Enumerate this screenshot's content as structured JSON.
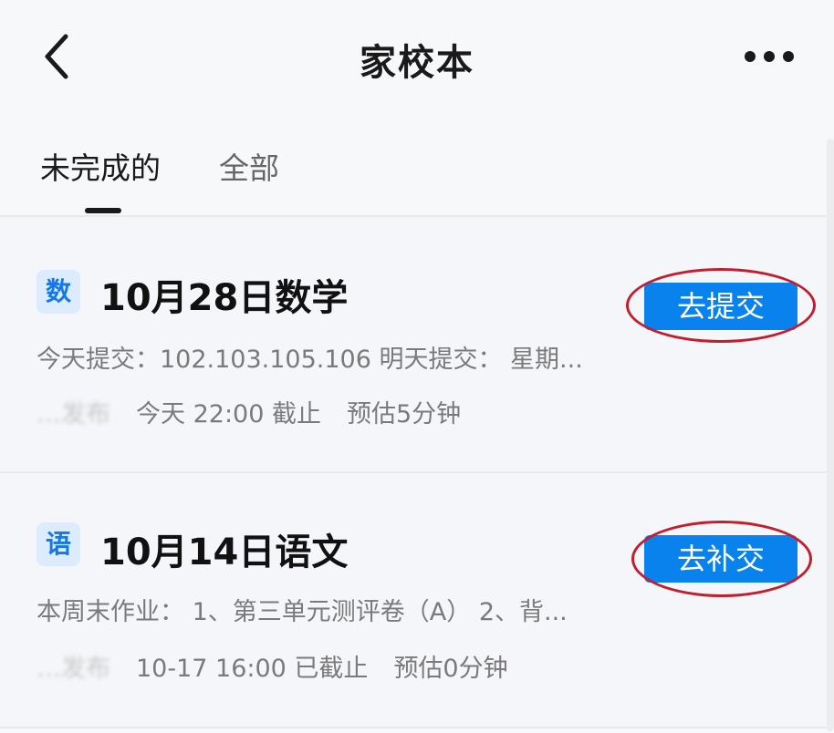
{
  "header": {
    "title": "家校本"
  },
  "tabs": [
    {
      "label": "未完成的",
      "active": true
    },
    {
      "label": "全部",
      "active": false
    }
  ],
  "assignments": [
    {
      "subject_badge": "数",
      "title": "10月28日数学",
      "description": "今天提交：102.103.105.106 明天提交： 星期...",
      "publisher": "…发布",
      "deadline": "今天 22:00 截止",
      "estimate": "预估5分钟",
      "action_label": "去提交"
    },
    {
      "subject_badge": "语",
      "title": "10月14日语文",
      "description": "本周末作业： 1、第三单元测评卷（A） 2、背...",
      "publisher": "…发布",
      "deadline": "10-17 16:00 已截止",
      "estimate": "预估0分钟",
      "action_label": "去补交"
    }
  ],
  "colors": {
    "accent": "#0a82ee",
    "badge_bg": "#dcecfd",
    "annotation": "#c21f2e"
  },
  "icons": {
    "back": "chevron-left-icon",
    "more": "more-dots-icon"
  }
}
